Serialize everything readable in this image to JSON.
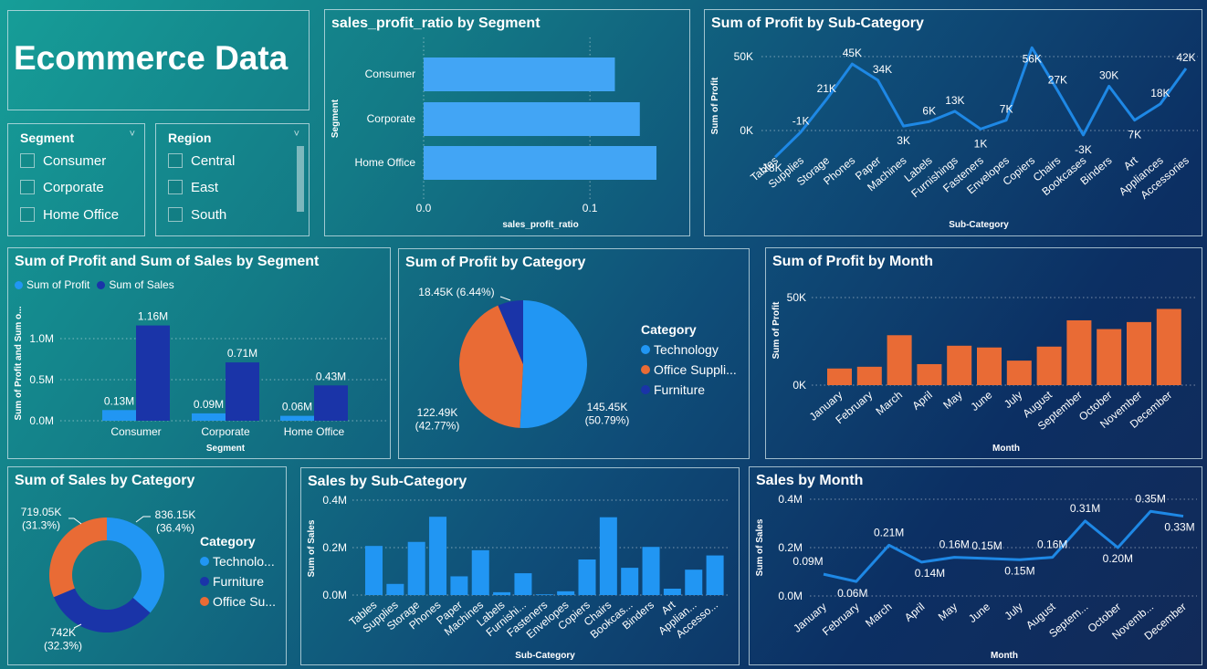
{
  "dashboard": {
    "title": "Ecommerce Data"
  },
  "colors": {
    "accent_blue": "#2196f3",
    "light_blue": "#42a5f5",
    "dark_blue": "#1a34a8",
    "orange": "#e96b35",
    "line_blue": "#1e88e5"
  },
  "slicers": {
    "segment": {
      "title": "Segment",
      "options": [
        "Consumer",
        "Corporate",
        "Home Office"
      ]
    },
    "region": {
      "title": "Region",
      "options": [
        "Central",
        "East",
        "South"
      ]
    }
  },
  "charts": {
    "ratio_by_segment": {
      "title": "sales_profit_ratio by Segment",
      "chart_data": {
        "type": "bar",
        "orientation": "horizontal",
        "categories": [
          "Consumer",
          "Corporate",
          "Home Office"
        ],
        "values": [
          0.115,
          0.13,
          0.14
        ],
        "xlabel": "sales_profit_ratio",
        "ylabel": "Segment",
        "xticks": [
          "0.0",
          "0.1"
        ],
        "xlim": [
          0,
          0.14
        ]
      }
    },
    "profit_by_subcategory": {
      "title": "Sum of Profit by Sub-Category",
      "chart_data": {
        "type": "line",
        "x": [
          "Tables",
          "Supplies",
          "Storage",
          "Phones",
          "Paper",
          "Machines",
          "Labels",
          "Furnishings",
          "Fasteners",
          "Envelopes",
          "Copiers",
          "Chairs",
          "Bookcases",
          "Binders",
          "Art",
          "Appliances",
          "Accessories"
        ],
        "values": [
          -18,
          -1,
          21,
          45,
          34,
          3,
          6,
          13,
          1,
          7,
          56,
          27,
          -3,
          30,
          7,
          18,
          42
        ],
        "labels": [
          "-18K",
          "-1K",
          "21K",
          "45K",
          "34K",
          "3K",
          "6K",
          "13K",
          "1K",
          "7K",
          "56K",
          "27K",
          "-3K",
          "30K",
          "7K",
          "18K",
          "42K"
        ],
        "xlabel": "Sub-Category",
        "ylabel": "Sum of Profit",
        "yticks": [
          "0K",
          "50K"
        ],
        "ylim": [
          -18,
          56
        ]
      }
    },
    "profit_sales_by_segment": {
      "title": "Sum of Profit and Sum of Sales by Segment",
      "legend": [
        "Sum of Profit",
        "Sum of Sales"
      ],
      "chart_data": {
        "type": "bar",
        "categories": [
          "Consumer",
          "Corporate",
          "Home Office"
        ],
        "series": [
          {
            "name": "Sum of Profit",
            "values": [
              0.13,
              0.09,
              0.06
            ],
            "labels": [
              "0.13M",
              "0.09M",
              "0.06M"
            ]
          },
          {
            "name": "Sum of Sales",
            "values": [
              1.16,
              0.71,
              0.43
            ],
            "labels": [
              "1.16M",
              "0.71M",
              "0.43M"
            ]
          }
        ],
        "xlabel": "Segment",
        "ylabel": "Sum of Profit and Sum o...",
        "yticks": [
          "0.0M",
          "0.5M",
          "1.0M"
        ],
        "ylim": [
          0,
          1.2
        ]
      }
    },
    "profit_by_category": {
      "title": "Sum of Profit by Category",
      "legend_title": "Category",
      "legend": [
        "Technology",
        "Office Suppli...",
        "Furniture"
      ],
      "chart_data": {
        "type": "pie",
        "categories": [
          "Technology",
          "Office Supplies",
          "Furniture"
        ],
        "values": [
          145.45,
          122.49,
          18.45
        ],
        "labels": [
          "145.45K\n(50.79%)",
          "122.49K\n(42.77%)",
          "18.45K (6.44%)"
        ]
      }
    },
    "profit_by_month": {
      "title": "Sum of Profit by Month",
      "chart_data": {
        "type": "bar",
        "categories": [
          "January",
          "February",
          "March",
          "April",
          "May",
          "June",
          "July",
          "August",
          "September",
          "October",
          "November",
          "December"
        ],
        "values": [
          9.5,
          10.5,
          28.5,
          12,
          22.5,
          21.5,
          14,
          22,
          37,
          32,
          36,
          43.5
        ],
        "xlabel": "Month",
        "ylabel": "Sum of Profit",
        "yticks": [
          "0K",
          "50K"
        ],
        "ylim": [
          0,
          50
        ]
      }
    },
    "sales_by_category": {
      "title": "Sum of Sales by Category",
      "legend_title": "Category",
      "legend": [
        "Technolo...",
        "Furniture",
        "Office Su..."
      ],
      "chart_data": {
        "type": "pie",
        "style": "donut",
        "categories": [
          "Technology",
          "Furniture",
          "Office Supplies"
        ],
        "values": [
          836.15,
          742,
          719.05
        ],
        "labels": [
          "836.15K\n(36.4%)",
          "742K\n(32.3%)",
          "719.05K\n(31.3%)"
        ]
      }
    },
    "sales_by_subcategory": {
      "title": "Sales by Sub-Category",
      "chart_data": {
        "type": "bar",
        "categories": [
          "Tables",
          "Supplies",
          "Storage",
          "Phones",
          "Paper",
          "Machines",
          "Labels",
          "Furnishi...",
          "Fasteners",
          "Envelopes",
          "Copiers",
          "Chairs",
          "Bookcas...",
          "Binders",
          "Art",
          "Applian...",
          "Accesso..."
        ],
        "values": [
          0.207,
          0.047,
          0.224,
          0.33,
          0.079,
          0.189,
          0.012,
          0.092,
          0.003,
          0.016,
          0.15,
          0.328,
          0.115,
          0.203,
          0.027,
          0.107,
          0.167
        ],
        "xlabel": "Sub-Category",
        "ylabel": "Sum of Sales",
        "yticks": [
          "0.0M",
          "0.2M",
          "0.4M"
        ],
        "ylim": [
          0,
          0.4
        ]
      }
    },
    "sales_by_month": {
      "title": "Sales by Month",
      "chart_data": {
        "type": "line",
        "x": [
          "January",
          "February",
          "March",
          "April",
          "May",
          "June",
          "July",
          "August",
          "Septem...",
          "October",
          "Novemb...",
          "December"
        ],
        "values": [
          0.09,
          0.06,
          0.21,
          0.14,
          0.16,
          0.155,
          0.15,
          0.16,
          0.31,
          0.2,
          0.35,
          0.33
        ],
        "labels": [
          "0.09M",
          "0.06M",
          "0.21M",
          "0.14M",
          "0.16M",
          "0.15M",
          "0.15M",
          "0.16M",
          "0.31M",
          "0.20M",
          "0.35M",
          "0.33M"
        ],
        "xlabel": "Month",
        "ylabel": "Sum of Sales",
        "yticks": [
          "0.0M",
          "0.2M",
          "0.4M"
        ],
        "ylim": [
          0,
          0.4
        ]
      }
    }
  }
}
